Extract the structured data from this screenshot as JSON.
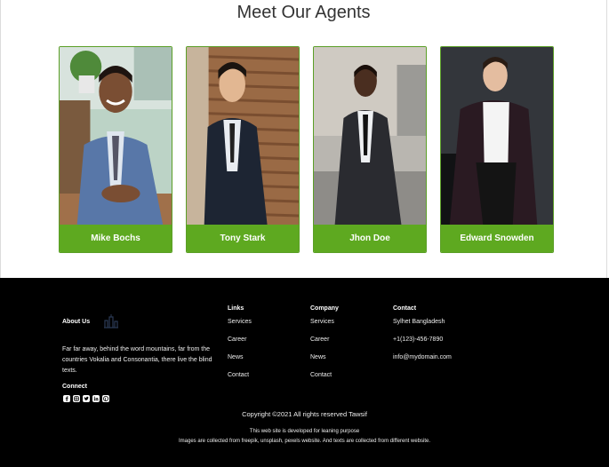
{
  "section_title": "Meet Our Agents",
  "agents": [
    {
      "name": "Mike Bochs"
    },
    {
      "name": "Tony Stark"
    },
    {
      "name": "Jhon Doe"
    },
    {
      "name": "Edward Snowden"
    }
  ],
  "footer": {
    "about": {
      "heading": "About Us",
      "text": "Far far away, behind the word mountains, far from the countries Vokalia and Consonantia, there live the blind texts.",
      "connect_heading": "Connect",
      "social_icons": [
        "facebook-icon",
        "instagram-icon",
        "twitter-icon",
        "linkedin-icon",
        "pinterest-icon"
      ]
    },
    "links": {
      "heading": "Links",
      "items": [
        "Services",
        "Career",
        "News",
        "Contact"
      ]
    },
    "company": {
      "heading": "Company",
      "items": [
        "Services",
        "Career",
        "News",
        "Contact"
      ]
    },
    "contact": {
      "heading": "Contact",
      "items": [
        "Sylhet Bangladesh",
        "+1(123)-456-7890",
        "info@mydomain.com"
      ]
    },
    "copyright": "Copyright ©2021 All rights reserved Tawsif",
    "note_1": "This web site is developed for leaning purpose",
    "note_2": "Images are collected from freepik, unsplash, pexels website. And texts are collected from different website."
  },
  "colors": {
    "accent_green": "#5ea920",
    "footer_bg": "#000000"
  }
}
